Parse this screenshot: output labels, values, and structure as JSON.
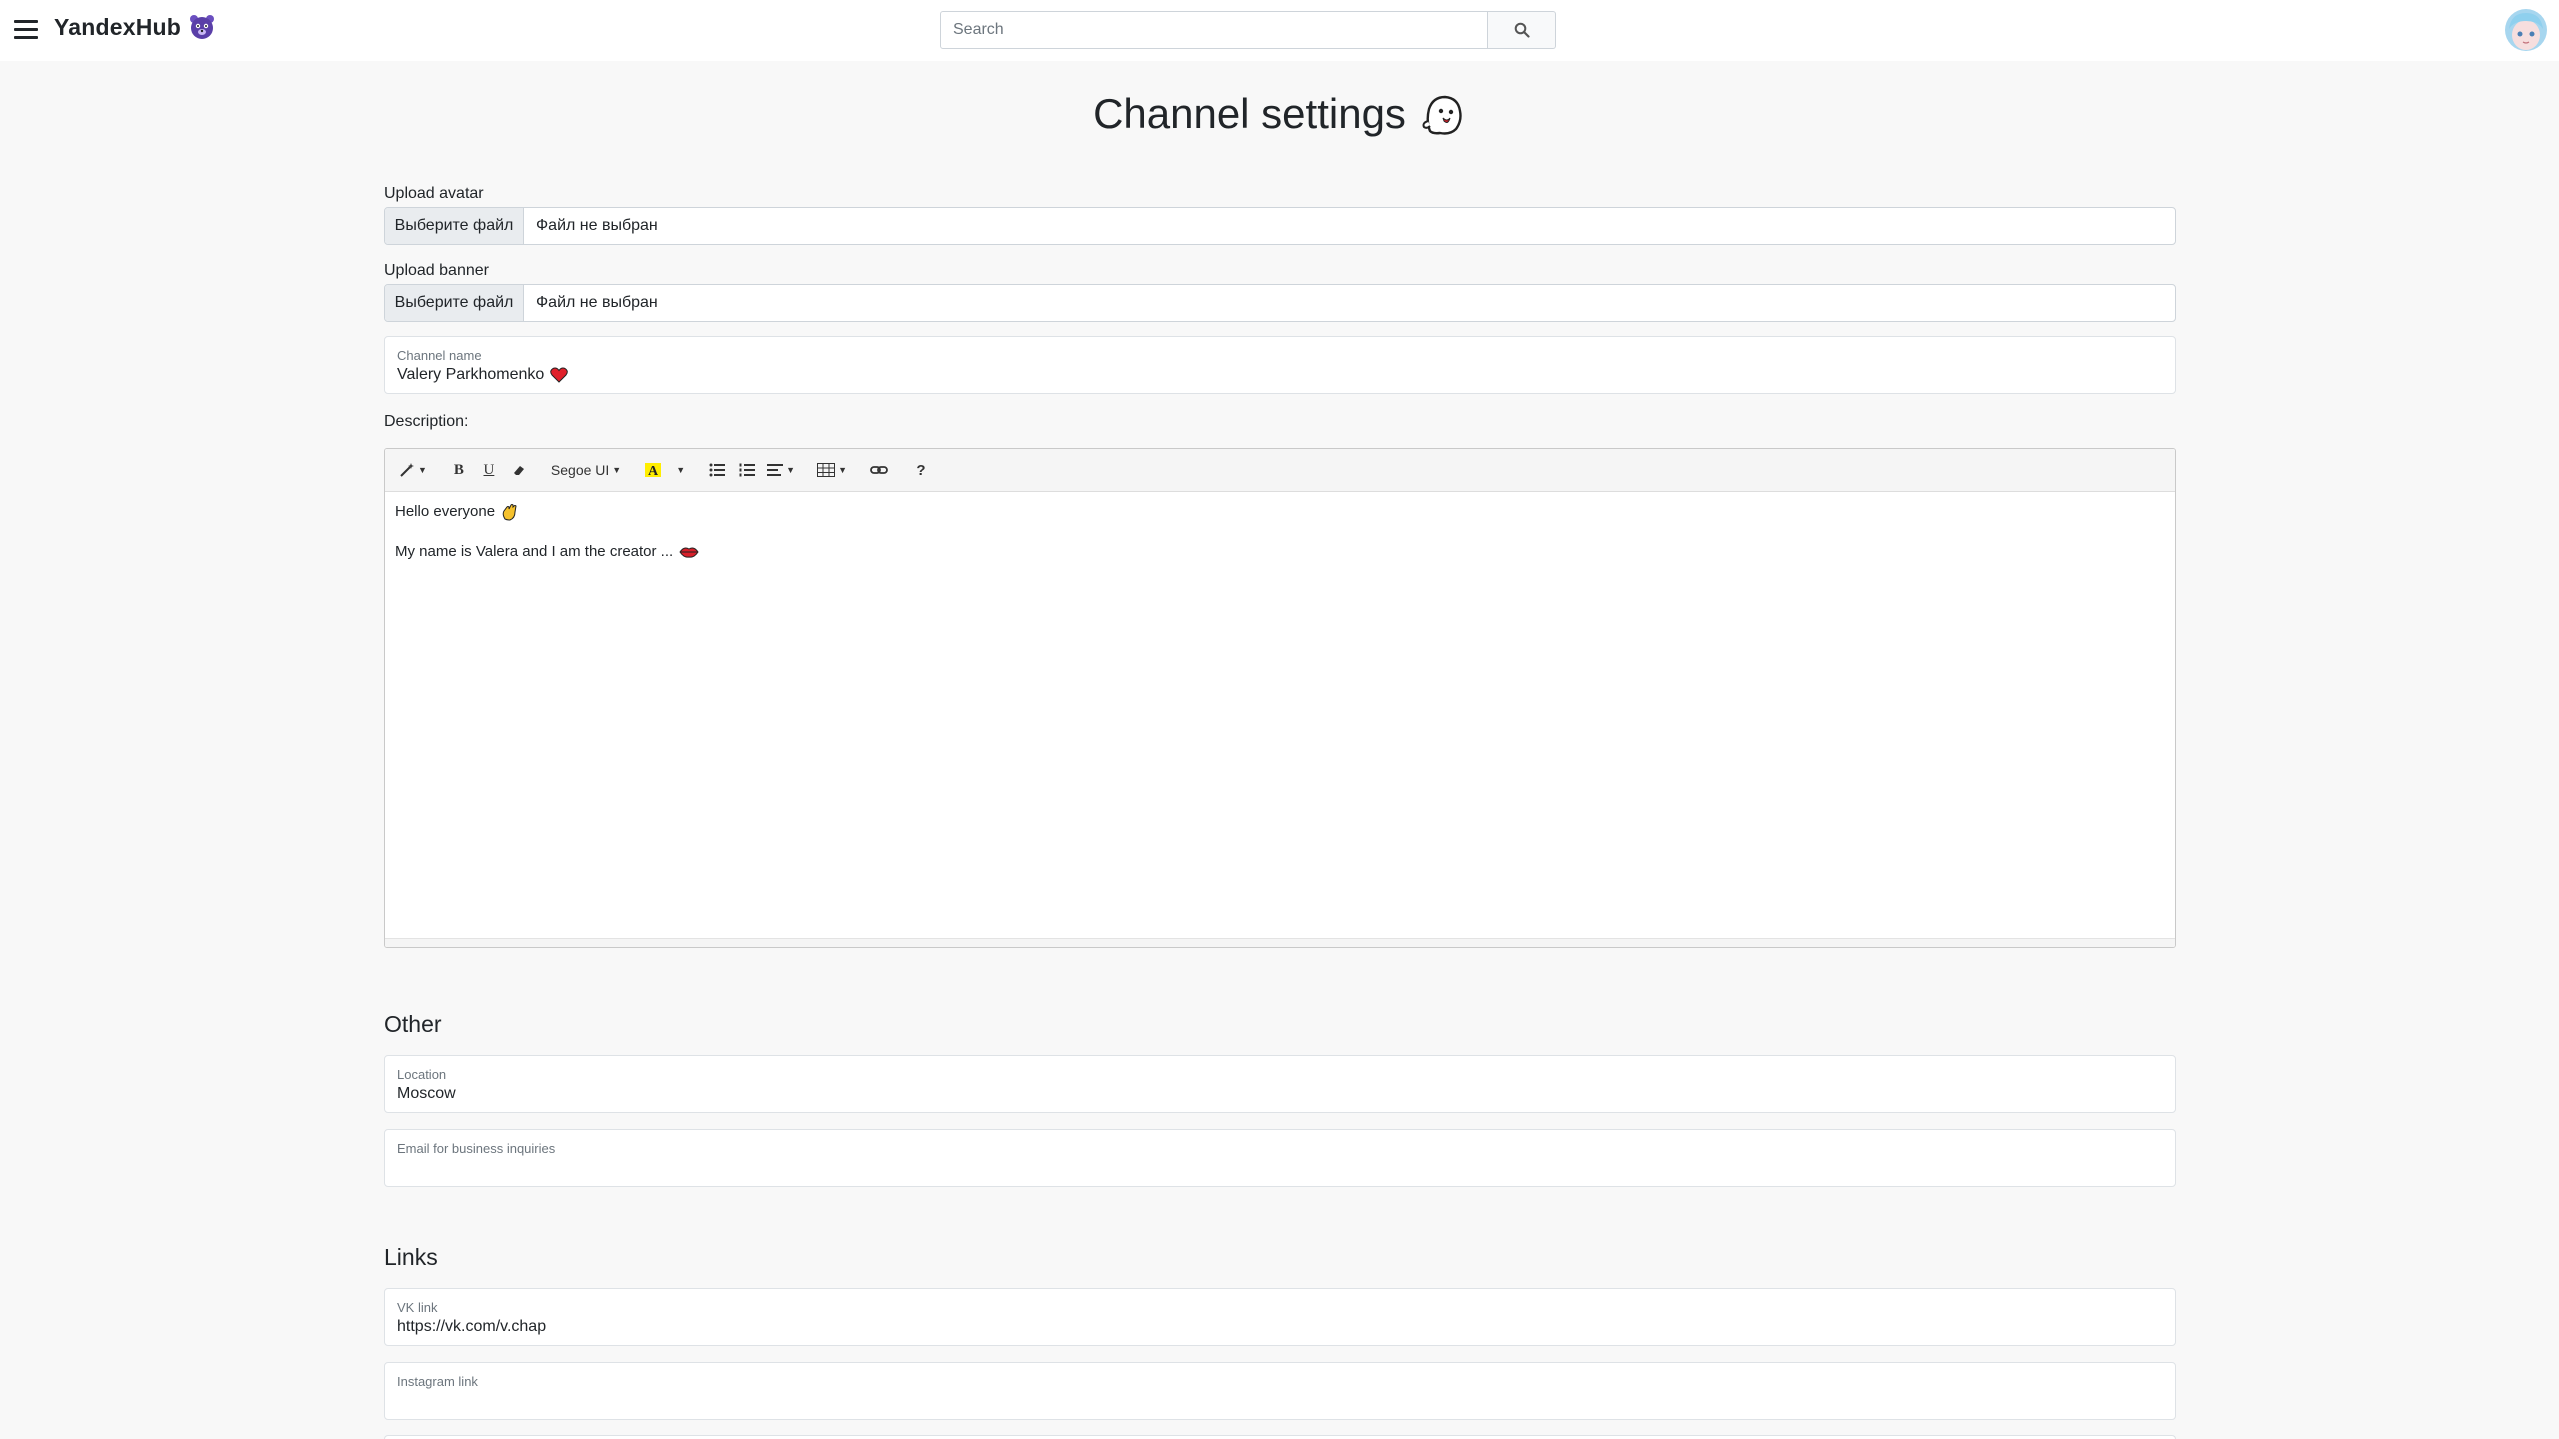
{
  "header": {
    "brand": "YandexHub",
    "search_placeholder": "Search"
  },
  "page": {
    "title": "Channel settings"
  },
  "upload_avatar": {
    "label": "Upload avatar",
    "button": "Выберите файл",
    "status": "Файл не выбран"
  },
  "upload_banner": {
    "label": "Upload banner",
    "button": "Выберите файл",
    "status": "Файл не выбран"
  },
  "channel_name": {
    "label": "Channel name",
    "value": "Valery Parkhomenko"
  },
  "description": {
    "label": "Description:",
    "toolbar": {
      "font_name": "Segoe UI",
      "help": "?"
    },
    "line1": "Hello everyone",
    "line2": "My name is Valera and I am the creator ..."
  },
  "other": {
    "title": "Other",
    "location_label": "Location",
    "location_value": "Moscow",
    "email_label": "Email for business inquiries",
    "email_value": ""
  },
  "links": {
    "title": "Links",
    "vk_label": "VK link",
    "vk_value": "https://vk.com/v.chap",
    "instagram_label": "Instagram link",
    "instagram_value": ""
  },
  "colors": {
    "accent": "#5a3fa8",
    "heart": "#e0202a",
    "highlight": "#ffee00"
  }
}
